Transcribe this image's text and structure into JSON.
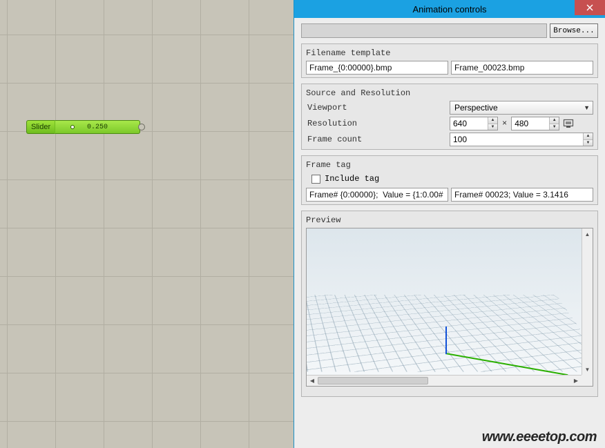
{
  "canvas": {
    "slider_label": "Slider",
    "slider_value": "0.250"
  },
  "panel": {
    "title": "Animation controls",
    "browse_button": "Browse...",
    "close_symbol": "×"
  },
  "filename": {
    "group_title": "Filename template",
    "template_value": "Frame_{0:00000}.bmp",
    "resolved_value": "Frame_00023.bmp"
  },
  "source": {
    "group_title": "Source and Resolution",
    "viewport_label": "Viewport",
    "viewport_value": "Perspective",
    "resolution_label": "Resolution",
    "resolution_w": "640",
    "resolution_sep": "×",
    "resolution_h": "480",
    "framecount_label": "Frame count",
    "framecount_value": "100"
  },
  "tag": {
    "group_title": "Frame tag",
    "include_label": "Include tag",
    "include_checked": false,
    "template_value": "Frame# {0:00000};  Value = {1:0.00#",
    "resolved_value": "Frame# 00023;  Value = 3.1416"
  },
  "preview": {
    "group_title": "Preview"
  },
  "watermark": "www.eeeetop.com"
}
